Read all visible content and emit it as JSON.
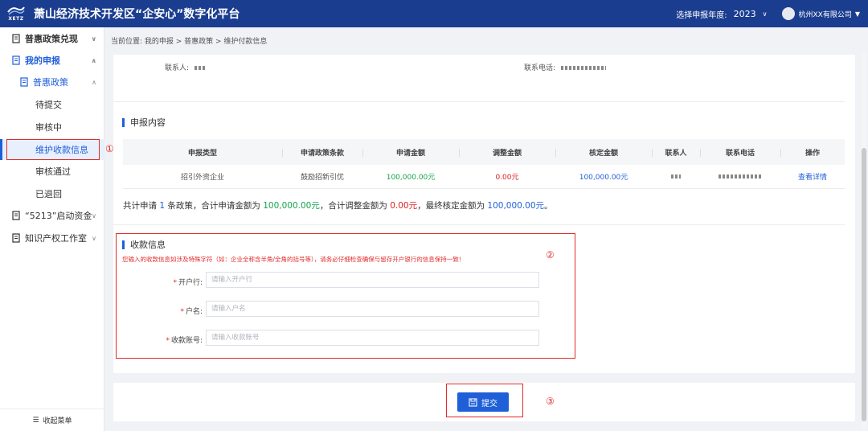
{
  "header": {
    "logo_text": "XETZ",
    "title": "萧山经济技术开发区“企安心”数字化平台",
    "year_label": "选择申报年度:",
    "year_value": "2023",
    "user_name": "杭州XX有限公司"
  },
  "sidebar": {
    "items": [
      {
        "label": "普惠政策兑现"
      },
      {
        "label": "我的申报"
      },
      {
        "label": "普惠政策"
      },
      {
        "label": "待提交"
      },
      {
        "label": "审核中"
      },
      {
        "label": "维护收款信息"
      },
      {
        "label": "审核通过"
      },
      {
        "label": "已退回"
      },
      {
        "label": "“5213”启动资金"
      },
      {
        "label": "知识产权工作室"
      }
    ],
    "collapse_label": "收起菜单"
  },
  "breadcrumb": "当前位置: 我的申报 > 普惠政策 > 维护付款信息",
  "contact": {
    "person_label": "联系人:",
    "phone_label": "联系电话:"
  },
  "declaration": {
    "title": "申报内容",
    "columns": [
      "申报类型",
      "申请政策条款",
      "申请金额",
      "调整金额",
      "核定金额",
      "联系人",
      "联系电话",
      "操作"
    ],
    "row": {
      "type": "招引外资企业",
      "clause": "鼓励招新引优",
      "apply_amount": "100,000.00元",
      "adjust_amount": "0.00元",
      "approved_amount": "100,000.00元",
      "action": "查看详情"
    },
    "summary": {
      "p1": "共计申请 ",
      "count": "1",
      "p2": " 条政策，合计申请金额为 ",
      "apply": "100,000.00元",
      "p3": "，合计调整金额为 ",
      "adjust": "0.00元",
      "p4": "，最终核定金额为 ",
      "approved": "100,000.00元",
      "p5": "。"
    }
  },
  "payment": {
    "title": "收款信息",
    "warning": "您输入的收款信息如涉及特殊字符（如：企业全称含半角/全角的括号等），请务必仔细检查确保与留存开户银行的信息保持一致！",
    "fields": [
      {
        "label": "开户行:",
        "placeholder": "请输入开户行"
      },
      {
        "label": "户名:",
        "placeholder": "请输入户名"
      },
      {
        "label": "收款账号:",
        "placeholder": "请输入收款账号"
      }
    ]
  },
  "submit_label": "提交",
  "annotations": [
    "①",
    "②",
    "③"
  ],
  "colors": {
    "header_bg": "#1b3d8f",
    "primary": "#1f5fd8",
    "green": "#17a34a",
    "red": "#d92020",
    "annotation": "#e32b2b"
  }
}
